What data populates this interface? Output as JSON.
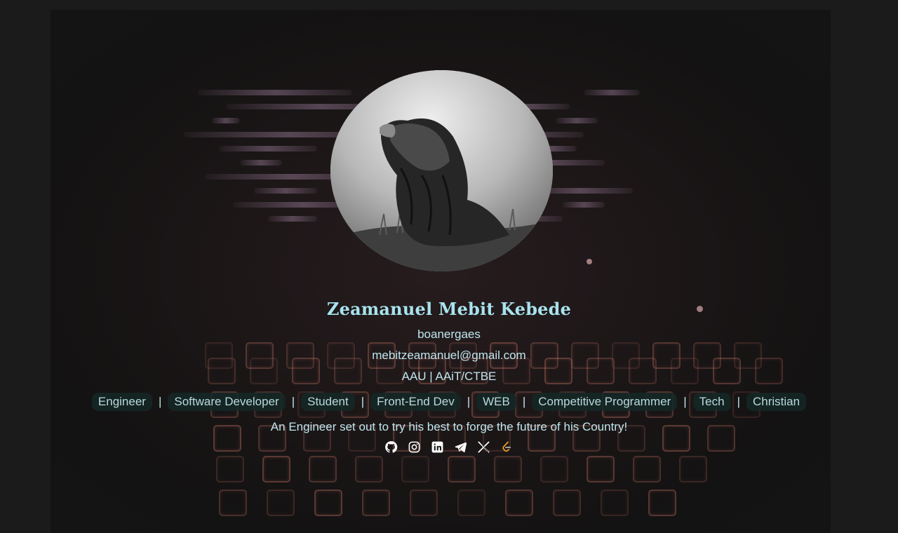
{
  "profile": {
    "name": "Zeamanuel Mebit Kebede",
    "handle": "boanergaes",
    "email": "mebitzeamanuel@gmail.com",
    "affiliation": "AAU | AAiT/CTBE",
    "tagline": "An Engineer set out to try his best to forge the future of his Country!"
  },
  "tags": [
    "Engineer",
    "Software Developer",
    "Student",
    "Front-End Dev",
    "WEB",
    "Competitive Programmer",
    "Tech",
    "Christian"
  ],
  "separator": "|",
  "socials": [
    "github-icon",
    "instagram-icon",
    "linkedin-icon",
    "telegram-icon",
    "x-icon",
    "leetcode-icon"
  ],
  "colors": {
    "name": "#a8e3ee",
    "text": "#bfe6ee",
    "tag_bg": "#142826",
    "background": "#181818"
  }
}
